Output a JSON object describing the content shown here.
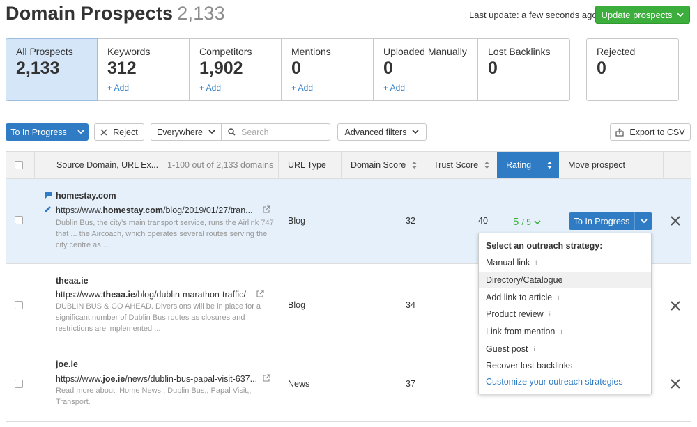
{
  "header": {
    "title": "Domain Prospects",
    "count": "2,133",
    "last_update": "Last update: a few seconds ago",
    "update_button": "Update prospects"
  },
  "cards": [
    {
      "label": "All Prospects",
      "value": "2,133",
      "add": ""
    },
    {
      "label": "Keywords",
      "value": "312",
      "add": "+ Add"
    },
    {
      "label": "Competitors",
      "value": "1,902",
      "add": "+ Add"
    },
    {
      "label": "Mentions",
      "value": "0",
      "add": "+ Add"
    },
    {
      "label": "Uploaded Manually",
      "value": "0",
      "add": "+ Add"
    },
    {
      "label": "Lost Backlinks",
      "value": "0",
      "add": ""
    },
    {
      "label": "Rejected",
      "value": "0",
      "add": ""
    }
  ],
  "toolbar": {
    "to_in_progress": "To In Progress",
    "reject": "Reject",
    "everywhere": "Everywhere",
    "search_placeholder": "Search",
    "advanced_filters": "Advanced filters",
    "export": "Export to CSV"
  },
  "table": {
    "headers": {
      "source": "Source Domain, URL Ex...",
      "range": "1-100 out of 2,133 domains",
      "url_type": "URL Type",
      "domain_score": "Domain Score",
      "trust_score": "Trust Score",
      "rating": "Rating",
      "move": "Move prospect"
    },
    "rows": [
      {
        "domain": "homestay.com",
        "url_pre": "https://www.",
        "url_bold": "homestay.com",
        "url_post": "/blog/2019/01/27/tran...",
        "desc": "Dublin Bus, the city's main transport service, runs the Airlink 747 that ... the Aircoach, which operates several routes serving the city centre as ...",
        "url_type": "Blog",
        "domain_score": "32",
        "trust_score": "40",
        "rating": "5",
        "rating_max": "/ 5",
        "move_button": "To In Progress"
      },
      {
        "domain": "theaa.ie",
        "url_pre": "https://www.",
        "url_bold": "theaa.ie",
        "url_post": "/blog/dublin-marathon-traffic/",
        "desc": "DUBLIN BUS & GO AHEAD. Diversions will be in place for a significant number of Dublin Bus routes as closures and restrictions are implemented ...",
        "url_type": "Blog",
        "domain_score": "34"
      },
      {
        "domain": "joe.ie",
        "url_pre": "https://www.",
        "url_bold": "joe.ie",
        "url_post": "/news/dublin-bus-papal-visit-637...",
        "desc": "Read more about: Home News,; Dublin Bus,; Papal Visit,; Transport.",
        "url_type": "News",
        "domain_score": "37"
      }
    ]
  },
  "dropdown": {
    "heading": "Select an outreach strategy:",
    "items": [
      "Manual link",
      "Directory/Catalogue",
      "Add link to article",
      "Product review",
      "Link from mention",
      "Guest post",
      "Recover lost backlinks"
    ],
    "info_glyph": "i",
    "customize": "Customize your outreach strategies"
  },
  "colors": {
    "accent_blue": "#2f7cc4",
    "green": "#3cae3c",
    "active_card": "#d4e6f7"
  }
}
